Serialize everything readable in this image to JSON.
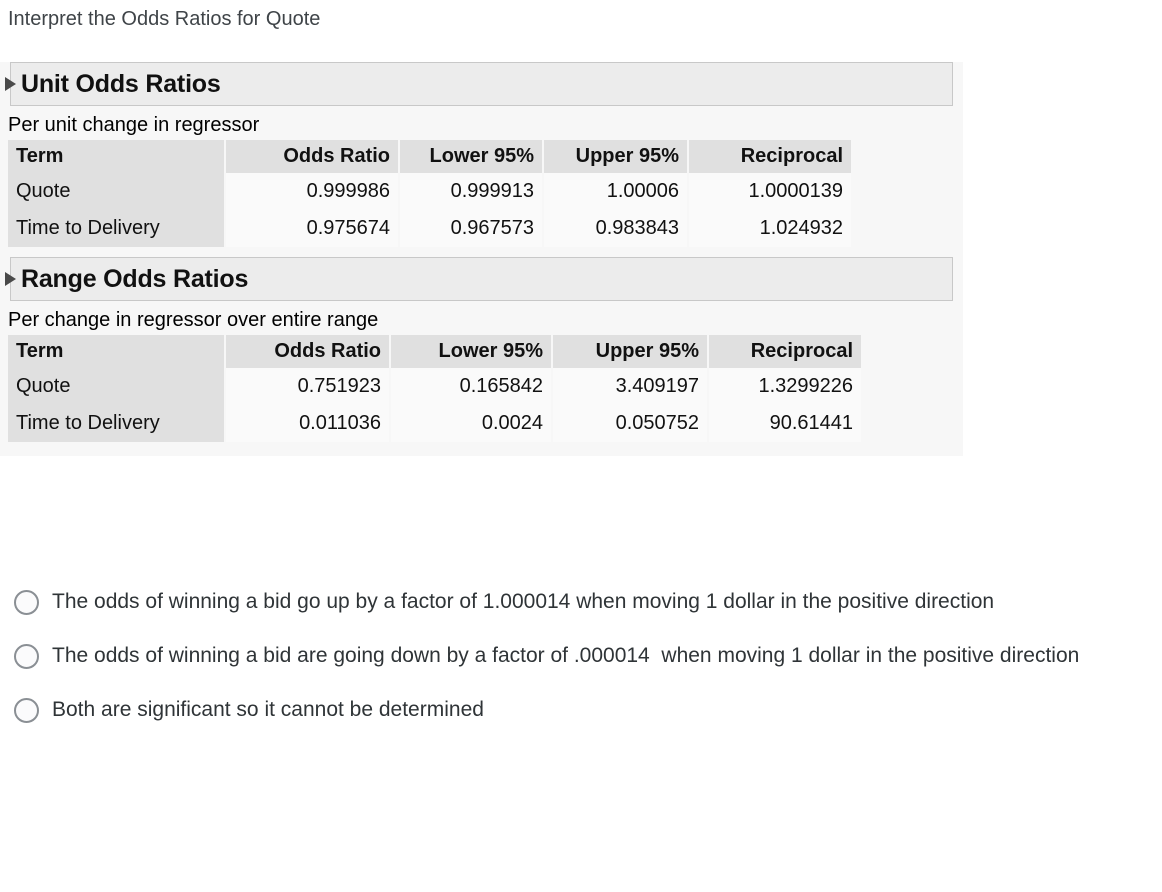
{
  "question": {
    "prompt": "Interpret the Odds Ratios for Quote"
  },
  "report": {
    "panels": [
      {
        "title": "Unit Odds Ratios",
        "subtitle": "Per unit change in regressor",
        "columns": [
          "Term",
          "Odds Ratio",
          "Lower 95%",
          "Upper 95%",
          "Reciprocal"
        ],
        "rows": [
          {
            "term": "Quote",
            "odds_ratio": "0.999986",
            "lower_95": "0.999913",
            "upper_95": "1.00006",
            "reciprocal": "1.0000139"
          },
          {
            "term": "Time to Delivery",
            "odds_ratio": "0.975674",
            "lower_95": "0.967573",
            "upper_95": "0.983843",
            "reciprocal": "1.024932"
          }
        ]
      },
      {
        "title": "Range Odds Ratios",
        "subtitle": "Per change in regressor over entire range",
        "columns": [
          "Term",
          "Odds Ratio",
          "Lower 95%",
          "Upper 95%",
          "Reciprocal"
        ],
        "rows": [
          {
            "term": "Quote",
            "odds_ratio": "0.751923",
            "lower_95": "0.165842",
            "upper_95": "3.409197",
            "reciprocal": "1.3299226"
          },
          {
            "term": "Time to Delivery",
            "odds_ratio": "0.011036",
            "lower_95": "0.0024",
            "upper_95": "0.050752",
            "reciprocal": "90.61441"
          }
        ]
      }
    ]
  },
  "answers": {
    "options": [
      {
        "text": "The odds of winning a bid go up by a factor of 1.000014 when moving 1 dollar in the positive direction",
        "selected": false
      },
      {
        "text": "The odds of winning a bid are going down by a factor of .000014  when moving 1 dollar in the positive direction",
        "selected": false
      },
      {
        "text": "Both are significant so it cannot be determined",
        "selected": false
      }
    ]
  },
  "colors": {
    "page_background": "#ffffff",
    "report_background": "#f7f7f7",
    "panel_header_background": "#ececec",
    "panel_header_border": "#c8c8c8",
    "table_header_background": "#e0e0e0",
    "table_cell_background": "#fafafa",
    "title_text": "#3f4448",
    "body_text": "#111111",
    "option_text": "#2f3437",
    "radio_border": "#8a8f94"
  }
}
